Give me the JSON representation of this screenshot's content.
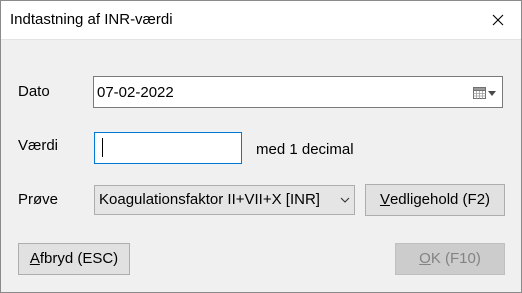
{
  "window": {
    "title": "Indtastning af INR-værdi",
    "close_icon": "close-icon"
  },
  "form": {
    "date_label": "Dato",
    "date_value": "07-02-2022",
    "calendar_icon": "calendar-icon",
    "value_label": "Værdi",
    "value_input": "",
    "value_hint": "med 1 decimal",
    "sample_label": "Prøve",
    "sample_selected": "Koagulationsfaktor II+VII+X [INR]"
  },
  "buttons": {
    "maintenance_mnemonic": "V",
    "maintenance_rest": "edligehold (F2)",
    "cancel_mnemonic": "A",
    "cancel_rest": "fbryd (ESC)",
    "ok_mnemonic": "O",
    "ok_rest": "K (F10)"
  },
  "colors": {
    "focus_border": "#0078d7",
    "disabled_text": "#838383"
  }
}
